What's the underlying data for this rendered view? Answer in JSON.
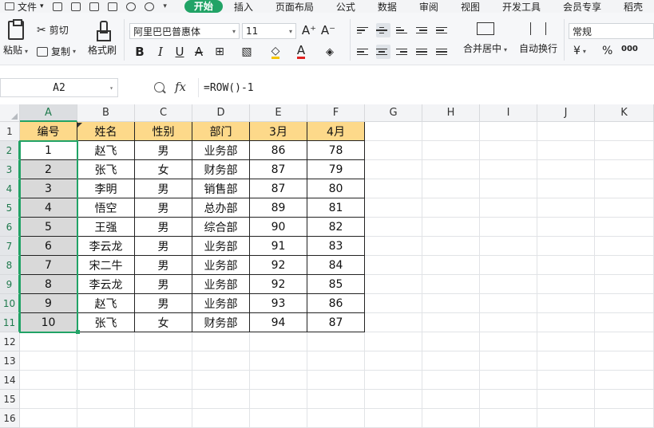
{
  "menubar": {
    "file_label": "文件",
    "tabs": [
      "开始",
      "插入",
      "页面布局",
      "公式",
      "数据",
      "审阅",
      "视图",
      "开发工具",
      "会员专享",
      "稻壳"
    ],
    "active_tab": "开始"
  },
  "ribbon": {
    "paste": "粘贴",
    "cut": "剪切",
    "copy": "复制",
    "format_painter": "格式刷",
    "font_name": "阿里巴巴普惠体",
    "font_size": "11",
    "bold": "B",
    "italic": "I",
    "underline": "U",
    "merge_center": "合并居中",
    "wrap_text": "自动换行",
    "number_format": "常规",
    "currency": "¥",
    "percent": "%",
    "thousands": "000",
    "increase_font": "A⁺",
    "decrease_font": "A⁻",
    "font_color_glyph": "A"
  },
  "formula_bar": {
    "name_box": "A2",
    "fx": "fx",
    "formula": "=ROW()-1"
  },
  "sheet": {
    "columns": [
      "A",
      "B",
      "C",
      "D",
      "E",
      "F",
      "G",
      "H",
      "I",
      "J",
      "K"
    ],
    "row_numbers": [
      "1",
      "2",
      "3",
      "4",
      "5",
      "6",
      "7",
      "8",
      "9",
      "10",
      "11",
      "12",
      "13",
      "14",
      "15",
      "16"
    ],
    "header": [
      "编号",
      "姓名",
      "性别",
      "部门",
      "3月",
      "4月"
    ],
    "rows": [
      [
        "1",
        "赵飞",
        "男",
        "业务部",
        "86",
        "78"
      ],
      [
        "2",
        "张飞",
        "女",
        "财务部",
        "87",
        "79"
      ],
      [
        "3",
        "李明",
        "男",
        "销售部",
        "87",
        "80"
      ],
      [
        "4",
        "悟空",
        "男",
        "总办部",
        "89",
        "81"
      ],
      [
        "5",
        "王强",
        "男",
        "综合部",
        "90",
        "82"
      ],
      [
        "6",
        "李云龙",
        "男",
        "业务部",
        "91",
        "83"
      ],
      [
        "7",
        "宋二牛",
        "男",
        "业务部",
        "92",
        "84"
      ],
      [
        "8",
        "李云龙",
        "男",
        "业务部",
        "92",
        "85"
      ],
      [
        "9",
        "赵飞",
        "男",
        "业务部",
        "93",
        "86"
      ],
      [
        "10",
        "张飞",
        "女",
        "财务部",
        "94",
        "87"
      ]
    ]
  },
  "colors": {
    "accent": "#21a366",
    "header_fill": "#fdd98a",
    "selected_fill": "#d9d9d9"
  }
}
